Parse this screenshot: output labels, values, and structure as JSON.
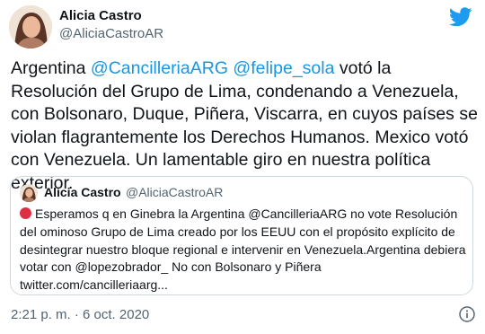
{
  "author": {
    "name": "Alicia Castro",
    "handle": "@AliciaCastroAR"
  },
  "tweet": {
    "t1": "Argentina ",
    "m1": "@CancilleriaARG",
    "t2": " ",
    "m2": "@felipe_sola",
    "t3": " votó la Resolución del Grupo de Lima, condenando a Venezuela, con Bolsonaro, Duque, Piñera, Viscarra, en cuyos países se violan flagrantemente los Derechos Humanos. Mexico votó con Venezuela. Un lamentable giro en nuestra política exterior."
  },
  "quote": {
    "name": "Alicia Castro",
    "handle": "@AliciaCastroAR",
    "text": "Esperamos q en Ginebra la Argentina @CancilleriaARG no vote Resolución del ominoso Grupo de Lima creado por los EEUU con el propósito explícito de desintegrar nuestro bloque regional e intervenir en Venezuela.Argentina debiera votar con @lopezobrador_ No con Bolsonaro y Piñera twitter.com/cancilleriaarg..."
  },
  "timestamp": "2:21 p. m. · 6 oct. 2020",
  "colors": {
    "link": "#1b95e0",
    "twitter_blue": "#1d9bf0",
    "muted": "#536471",
    "red_circle": "#dd2e44"
  },
  "icons": [
    "avatar",
    "twitter-bird-icon",
    "red-circle-emoji-icon",
    "info-icon"
  ]
}
